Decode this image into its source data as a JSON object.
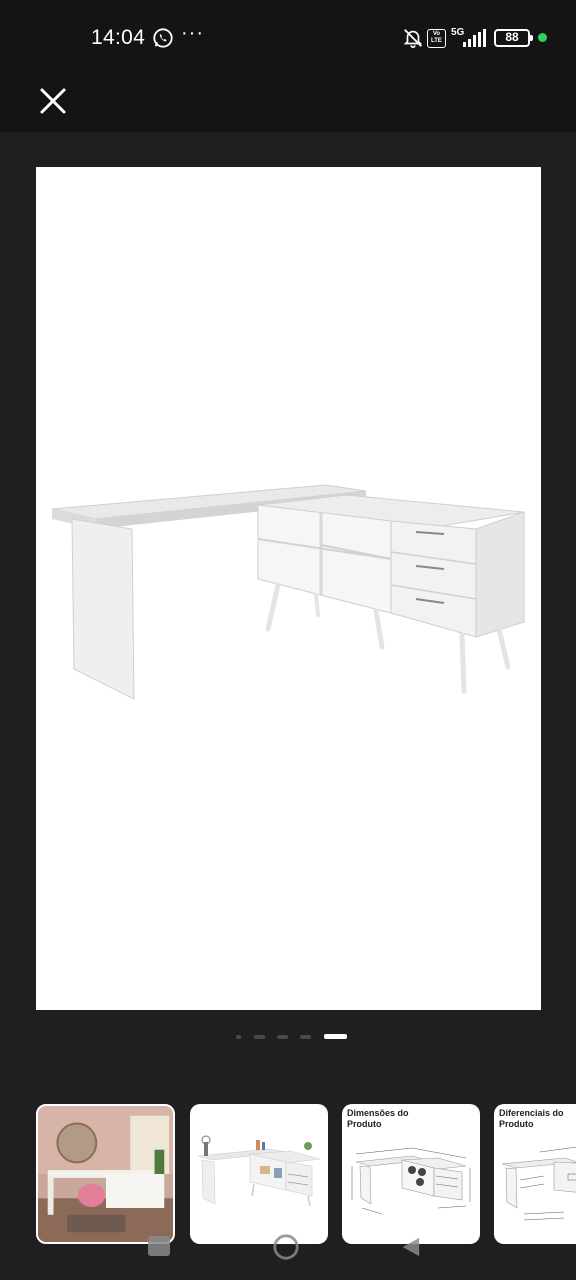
{
  "status_bar": {
    "time": "14:04",
    "overflow": "···",
    "network": "5G",
    "volte": "Vo LTE",
    "battery": "88",
    "icons": [
      "whatsapp-icon",
      "mute-icon",
      "signal-icon",
      "battery-icon"
    ]
  },
  "top_bar": {
    "close_icon": "close-icon"
  },
  "gallery": {
    "main_image": "white L-shaped desk with shelves and three drawers",
    "page_count": 5,
    "active_page": 5
  },
  "thumbnails": [
    {
      "name": "thumb-room-scene",
      "title": ""
    },
    {
      "name": "thumb-desk-props",
      "title": ""
    },
    {
      "name": "thumb-dimensions",
      "title": "Dimensões do Produto"
    },
    {
      "name": "thumb-features",
      "title": "Diferenciais do Produto"
    }
  ],
  "nav_bar": {
    "buttons": [
      "recents-button",
      "home-button",
      "back-button"
    ]
  },
  "colors": {
    "background": "#1f1f21",
    "status_bar": "#141414",
    "charging": "#2fd158"
  }
}
